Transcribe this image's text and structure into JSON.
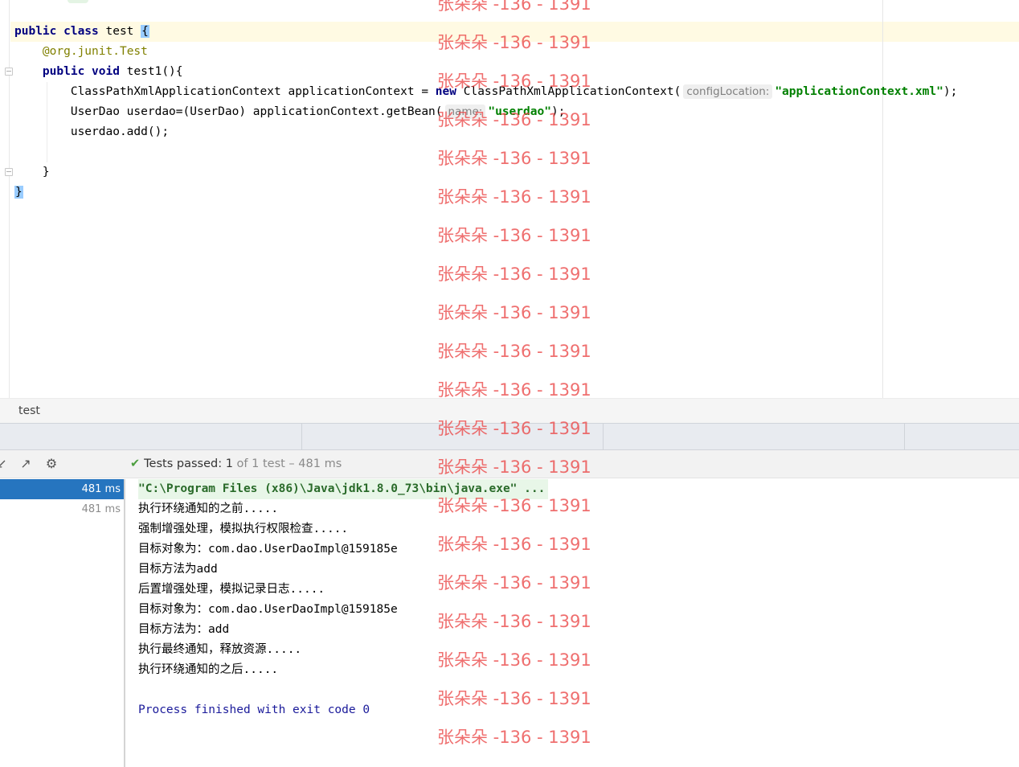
{
  "editor": {
    "lines": [
      {
        "parts": [
          {
            "t": "public class",
            "c": "kw"
          },
          {
            "t": " test ",
            "c": ""
          },
          {
            "t": "{",
            "c": "brace-hl"
          }
        ]
      },
      {
        "parts": [
          {
            "t": "    @org.junit.",
            "c": "ann0"
          },
          {
            "t": "Test",
            "c": "ann"
          }
        ]
      },
      {
        "parts": [
          {
            "t": "    public void",
            "c": "kw"
          },
          {
            "t": " test1(){",
            "c": ""
          }
        ]
      },
      {
        "parts": [
          {
            "t": "        ClassPathXmlApplicationContext applicationContext = ",
            "c": ""
          },
          {
            "t": "new",
            "c": "kw"
          },
          {
            "t": " ClassPathXmlApplicationContext(",
            "c": ""
          },
          {
            "t": "configLocation:",
            "c": "hint"
          },
          {
            "t": "\"applicationContext.xml\"",
            "c": "str"
          },
          {
            "t": ");",
            "c": ""
          }
        ]
      },
      {
        "parts": [
          {
            "t": "        UserDao userdao=(UserDao) applicationContext.getBean(",
            "c": ""
          },
          {
            "t": "name:",
            "c": "hint"
          },
          {
            "t": "\"userdao\"",
            "c": "str"
          },
          {
            "t": ");",
            "c": ""
          }
        ]
      },
      {
        "parts": [
          {
            "t": "        userdao.add();",
            "c": ""
          }
        ]
      },
      {
        "parts": [
          {
            "t": "",
            "c": ""
          }
        ]
      },
      {
        "parts": [
          {
            "t": "    }",
            "c": ""
          }
        ]
      },
      {
        "parts": [
          {
            "t": "}",
            "c": "brace-hl"
          }
        ]
      }
    ]
  },
  "breadcrumb": {
    "item": "test"
  },
  "run": {
    "status_prefix": "Tests passed: ",
    "status_count": "1",
    "status_rest": " of 1 test – 481 ms",
    "tree": [
      {
        "label": "481 ms",
        "selected": true
      },
      {
        "label": "481 ms",
        "selected": false
      }
    ],
    "console": {
      "command": "\"C:\\Program Files (x86)\\Java\\jdk1.8.0_73\\bin\\java.exe\" ...",
      "lines": [
        "执行环绕通知的之前.....",
        "强制增强处理，模拟执行权限检查.....",
        "目标对象为：com.dao.UserDaoImpl@159185e",
        "目标方法为add",
        "后置增强处理，模拟记录日志.....",
        "目标对象为：com.dao.UserDaoImpl@159185e",
        "目标方法为：add",
        "执行最终通知，释放资源.....",
        "执行环绕通知的之后....."
      ],
      "process": "Process finished with exit code 0"
    }
  },
  "watermark": {
    "text": "张朵朵 -136 - 1391"
  },
  "colors": {
    "keyword": "#000080",
    "annotation": "#808000",
    "string": "#008000",
    "selection": "#2675bf",
    "watermark": "#eb4646"
  }
}
